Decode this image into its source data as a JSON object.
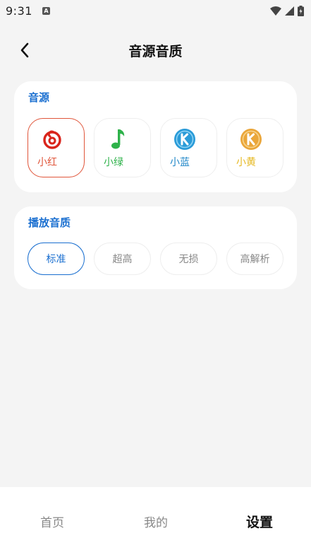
{
  "status_bar": {
    "time": "9:31",
    "app_icon_letter": "A"
  },
  "header": {
    "title": "音源音质",
    "back_icon": "chevron-left-icon"
  },
  "source_section": {
    "title": "音源",
    "items": [
      {
        "label": "小红",
        "icon": "netease-icon",
        "color": "#e0553a",
        "selected": true
      },
      {
        "label": "小绿",
        "icon": "music-note-icon",
        "color": "#2eb24a",
        "selected": false
      },
      {
        "label": "小蓝",
        "icon": "kugou-blue-icon",
        "color": "#1f86c8",
        "selected": false
      },
      {
        "label": "小黄",
        "icon": "kuwo-yellow-icon",
        "color": "#e6b820",
        "selected": false
      }
    ]
  },
  "quality_section": {
    "title": "播放音质",
    "options": [
      {
        "label": "标准",
        "selected": true
      },
      {
        "label": "超高",
        "selected": false
      },
      {
        "label": "无损",
        "selected": false
      },
      {
        "label": "高解析",
        "selected": false
      }
    ]
  },
  "bottom_nav": {
    "items": [
      {
        "label": "首页",
        "active": false
      },
      {
        "label": "我的",
        "active": false
      },
      {
        "label": "设置",
        "active": true
      }
    ]
  },
  "colors": {
    "accent_blue": "#1a6fd0",
    "selected_red": "#e0553a",
    "background": "#f4f4f4"
  }
}
